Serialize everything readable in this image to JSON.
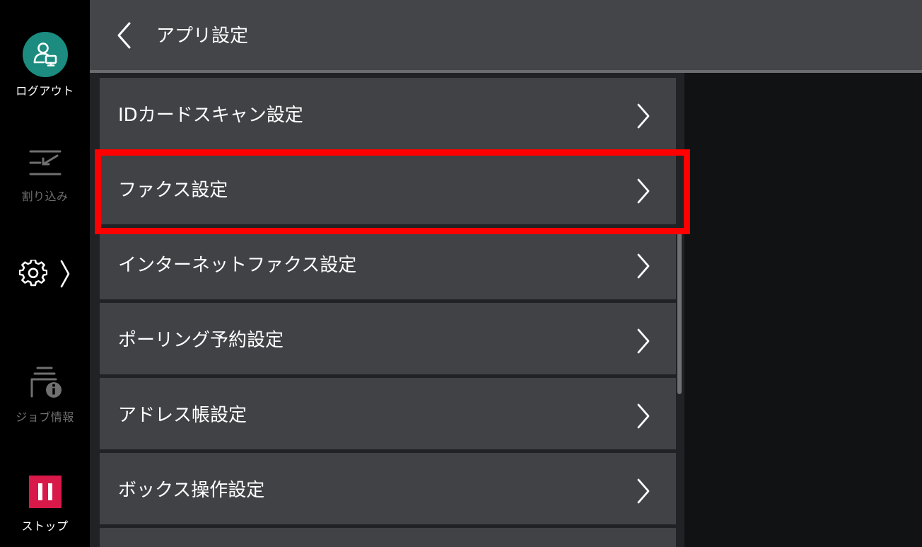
{
  "sidebar": {
    "logout": {
      "label": "ログアウト",
      "icon": "user-monitor-icon"
    },
    "interrupt": {
      "label": "割り込み",
      "icon": "interrupt-icon",
      "enabled": false
    },
    "settings": {
      "icon": "gear-icon"
    },
    "job_info": {
      "label": "ジョブ情報",
      "icon": "job-info-icon",
      "enabled": false
    },
    "stop": {
      "label": "ストップ",
      "icon": "pause-icon",
      "color": "#d8194a"
    }
  },
  "header": {
    "title": "アプリ設定",
    "back_icon": "chevron-left-icon"
  },
  "menu": {
    "items": [
      {
        "label": "IDカードスキャン設定"
      },
      {
        "label": "ファクス設定",
        "highlighted": true
      },
      {
        "label": "インターネットファクス設定"
      },
      {
        "label": "ポーリング予約設定"
      },
      {
        "label": "アドレス帳設定"
      },
      {
        "label": "ボックス操作設定"
      }
    ]
  },
  "colors": {
    "accent": "#1b8c7f",
    "highlight": "#ff0000",
    "stop": "#d8194a",
    "menu_item_bg": "#404246",
    "header_bg": "#434549"
  }
}
